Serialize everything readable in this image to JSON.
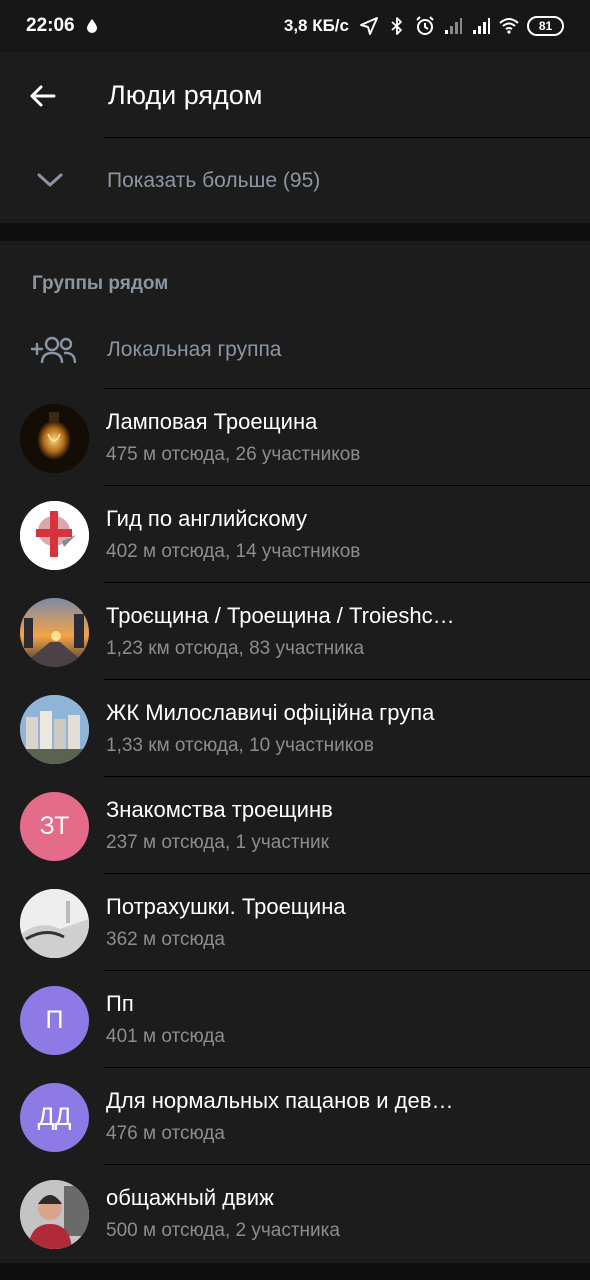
{
  "status_bar": {
    "time": "22:06",
    "speed": "3,8 КБ/с",
    "battery": "81",
    "icons": [
      "drop-icon",
      "location-arrow-icon",
      "bluetooth-icon",
      "alarm-icon",
      "signal-icon",
      "signal-icon",
      "wifi-icon",
      "battery-icon"
    ]
  },
  "appbar": {
    "title": "Люди рядом",
    "back_icon": "arrow-left-icon"
  },
  "show_more": {
    "label": "Показать больше (95)",
    "icon": "chevron-down-icon"
  },
  "groups": {
    "header": "Группы рядом",
    "create_local": {
      "label": "Локальная группа",
      "icon": "add-group-icon"
    },
    "items": [
      {
        "title": "Ламповая Троещина",
        "subtitle": "475 м отсюда, 26 участников",
        "avatar_type": "photo-lamp"
      },
      {
        "title": "Гид по английскому",
        "subtitle": "402 м отсюда, 14 участников",
        "avatar_type": "photo-flag"
      },
      {
        "title": "Троєщина / Троещина / Troieshc…",
        "subtitle": "1,23 км отсюда, 83 участника",
        "avatar_type": "photo-sunset"
      },
      {
        "title": "ЖК Милославичі офіційна група",
        "subtitle": "1,33 км отсюда, 10 участников",
        "avatar_type": "photo-buildings"
      },
      {
        "title": "Знакомства троещинв",
        "subtitle": "237 м отсюда, 1 участник",
        "avatar_type": "initials",
        "initials": "ЗТ",
        "color": "#e56b8a"
      },
      {
        "title": "Потрахушки. Троещина",
        "subtitle": "362 м отсюда",
        "avatar_type": "photo-white"
      },
      {
        "title": "Пп",
        "subtitle": "401 м отсюда",
        "avatar_type": "initials",
        "initials": "П",
        "color": "#8e7ae4"
      },
      {
        "title": "Для нормальных пацанов и дев…",
        "subtitle": "476 м отсюда",
        "avatar_type": "initials",
        "initials": "ДД",
        "color": "#8e7ae4"
      },
      {
        "title": "общажный движ",
        "subtitle": "500 м отсюда, 2 участника",
        "avatar_type": "photo-person"
      }
    ]
  }
}
